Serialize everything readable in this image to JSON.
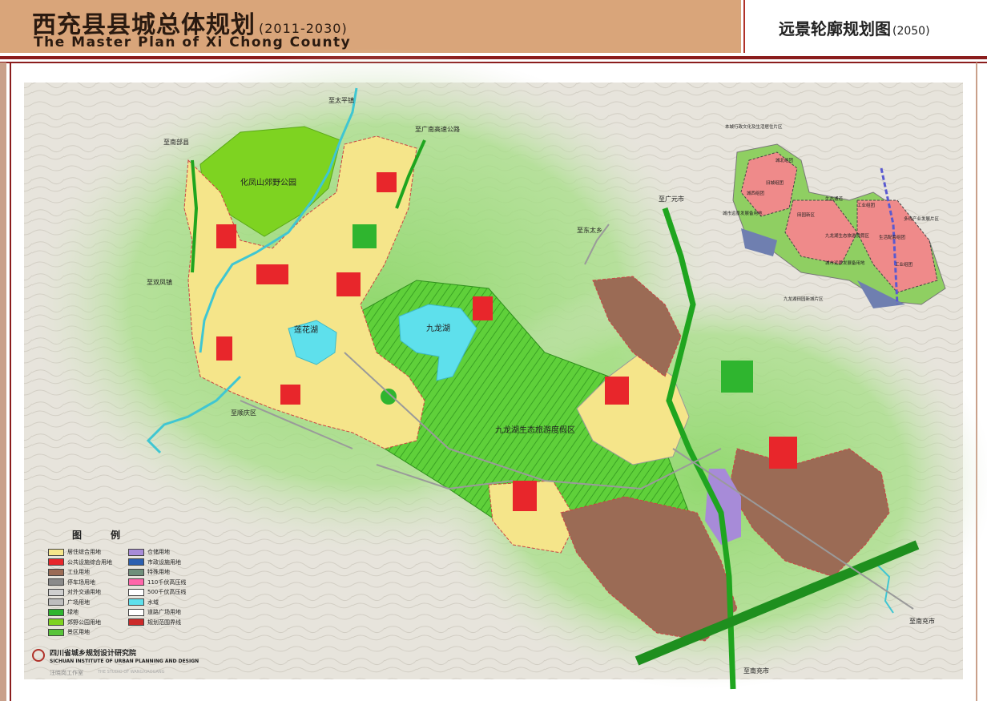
{
  "header": {
    "title_cn": "西充县县城总体规划",
    "title_years": "(2011-2030)",
    "title_en": "The Master Plan of Xi Chong County",
    "map_title": "远景轮廓规划图",
    "map_title_year": "(2050)"
  },
  "map_labels": {
    "park": "化凤山郊野公园",
    "lake": "九龙湖",
    "lotus": "莲花湖",
    "resort": "九龙湖生态旅游度假区",
    "to_taiping": "至太平镇",
    "to_nanbu": "至南部县",
    "to_guangnan": "至广南高速公路",
    "to_guangyuan": "至广元市",
    "to_dongtai": "至东太乡",
    "to_shuangfeng": "至双凤镇",
    "to_shunqing": "至顺庆区",
    "to_nanchong_1": "至南充市",
    "to_nanchong_2": "至南充市"
  },
  "inset_labels": [
    "本城行政文化及生活居住片区",
    "城北组团",
    "旧城组团",
    "城西组团",
    "城市远景发展备用地",
    "生态通道",
    "田园新区",
    "九龙湖生态旅游度假区",
    "城市远景发展备用地",
    "九龙湖田园新城片区",
    "工业组团",
    "多线产业发展片区",
    "生活配套组团",
    "工业组团"
  ],
  "legend": {
    "title": "图例",
    "items": [
      {
        "label": "居住综合用地",
        "color": "#f5e58a"
      },
      {
        "label": "公共设施综合用地",
        "color": "#e8262b"
      },
      {
        "label": "工业用地",
        "color": "#9b6b55"
      },
      {
        "label": "停车场用地",
        "color": "#8a8a8a"
      },
      {
        "label": "对外交通用地",
        "color": "#cfcfcf"
      },
      {
        "label": "广场用地",
        "color": "#bdbdbd"
      },
      {
        "label": "绿地",
        "color": "#2fb52f"
      },
      {
        "label": "郊野公园用地",
        "color": "#7ed321"
      },
      {
        "label": "景区用地",
        "color": "#58c43a"
      },
      {
        "label": "仓储用地",
        "color": "#a78bd8"
      },
      {
        "label": "市政设施用地",
        "color": "#2b5fb0"
      },
      {
        "label": "特殊用地",
        "color": "#6f8f7b"
      },
      {
        "label": "110千伏高压线",
        "color": "#ff66aa"
      },
      {
        "label": "500千伏高压线",
        "color": "#ffffff"
      },
      {
        "label": "水域",
        "color": "#5ee0ec"
      },
      {
        "label": "道路广场用地",
        "color": "#ffffff"
      },
      {
        "label": "规划范围界线",
        "color": "#cc2a2a"
      }
    ]
  },
  "institute": {
    "name_cn": "四川省城乡规划设计研究院",
    "name_en": "SICHUAN INSTITUTE OF URBAN PLANNING AND DESIGN",
    "studio_cn": "汪晓岗工作室",
    "studio_en": "THE STUDIO OF WANGXIAOGANG"
  },
  "colors": {
    "header_bg": "#d9a57a",
    "rule": "#8b1d1d",
    "terrain": "#e9e6df",
    "green_buffer": "#8fd36a",
    "residential": "#f5e58a",
    "industrial": "#9b6b55",
    "public": "#e8262b",
    "water": "#5ee0ec"
  }
}
